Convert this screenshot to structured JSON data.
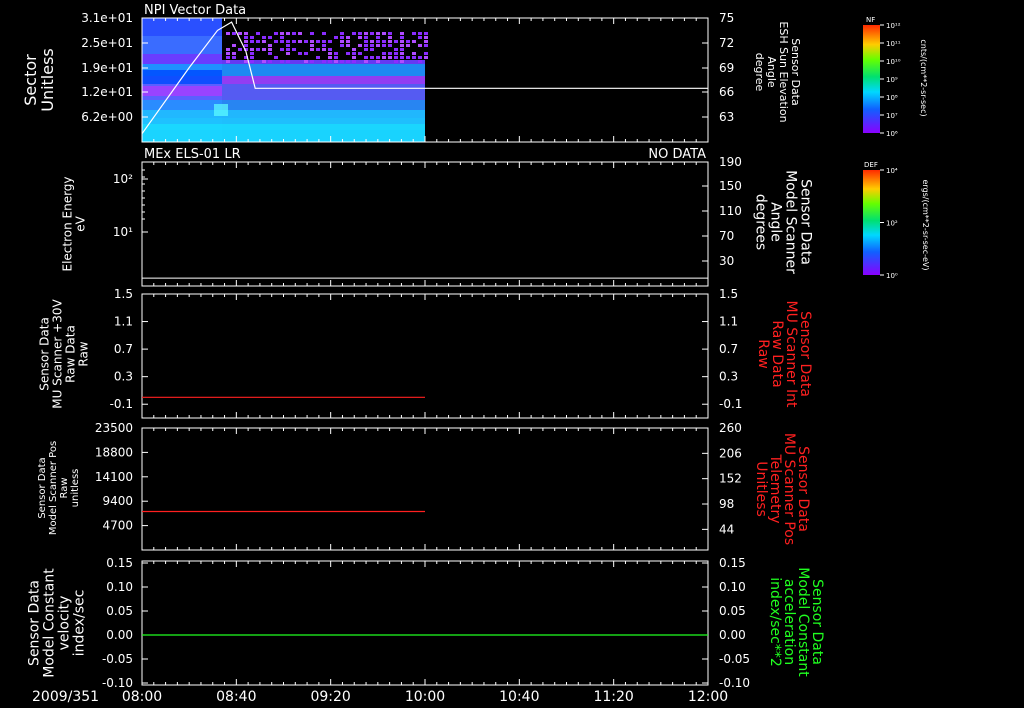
{
  "colors": {
    "background": "#000000",
    "foreground": "#ffffff",
    "right_axis_red": "#ff2020",
    "right_axis_green": "#20ff20",
    "trace_red": "#ff2020",
    "trace_green": "#20ff20",
    "trace_white": "#ffffff"
  },
  "time_axis": {
    "date_label": "2009/351",
    "ticks": [
      "08:00",
      "08:40",
      "09:20",
      "10:00",
      "10:40",
      "11:20",
      "12:00"
    ],
    "data_end": "10:00"
  },
  "chart_data": [
    {
      "type": "heatmap",
      "title": "NPI Vector Data",
      "ylabel": "Sector\nUnitless",
      "y_ticks": [
        "3.1e+01",
        "2.5e+01",
        "1.9e+01",
        "1.2e+01",
        "6.2e+00"
      ],
      "right_axis": {
        "label": "Sensor Data\nESH Sun Elevation\nAngle\ndegree",
        "ticks": [
          "75",
          "72",
          "69",
          "66",
          "63"
        ],
        "ylim": [
          60,
          75
        ],
        "color": "#ffffff"
      },
      "overlay_series": {
        "name": "ESH Sun Elevation Angle",
        "x": [
          "08:00",
          "08:20",
          "08:32",
          "08:38",
          "08:44",
          "08:48",
          "10:00",
          "12:00"
        ],
        "y": [
          61,
          69,
          73.5,
          74.5,
          71,
          66.5,
          66.5,
          66.5
        ],
        "color": "#ffffff"
      },
      "colorbar": {
        "label": "NF",
        "units": "cnts/(cm**2-sr-sec)",
        "ticks": [
          "10¹²",
          "10¹¹",
          "10¹⁰",
          "10⁹",
          "10⁸",
          "10⁷",
          "10⁶"
        ]
      }
    },
    {
      "type": "line",
      "title": "MEx ELS-01 LR",
      "status": "NO DATA",
      "ylabel": "Electron Energy\neV",
      "y_ticks": [
        "10²",
        "10¹"
      ],
      "right_axis": {
        "label": "Sensor Data\nModel Scanner\nAngle\ndegrees",
        "ticks": [
          "190",
          "150",
          "110",
          "70",
          "30"
        ],
        "ylim": [
          0,
          190
        ],
        "color": "#ffffff"
      },
      "series": [
        {
          "name": "Scanner Angle",
          "x": [
            "08:00",
            "12:00"
          ],
          "y": [
            12,
            12
          ],
          "color": "#ffffff"
        }
      ],
      "colorbar": {
        "label": "DEF",
        "units": "ergs/(cm**2-sr-sec-eV)",
        "ticks": [
          "10⁴",
          "10²",
          "10⁰"
        ]
      }
    },
    {
      "type": "line",
      "ylabel": "Sensor Data\nMU Scanner +30V\nRaw Data\nRaw",
      "y_ticks": [
        "1.5",
        "1.1",
        "0.7",
        "0.3",
        "-0.1"
      ],
      "ylim": [
        -0.3,
        1.5
      ],
      "right_axis": {
        "label": "Sensor Data\nMU Scanner Int\nRaw Data\nRaw",
        "ticks": [
          "1.5",
          "1.1",
          "0.7",
          "0.3",
          "-0.1"
        ],
        "color": "#ff2020"
      },
      "series": [
        {
          "name": "MU Scanner Int Raw Data",
          "x": [
            "08:00",
            "10:00"
          ],
          "y": [
            0.0,
            0.0
          ],
          "color": "#ff2020"
        }
      ]
    },
    {
      "type": "line",
      "ylabel": "Sensor Data\nModel Scanner Pos\nRaw\nunitless",
      "y_ticks": [
        "23500",
        "18800",
        "14100",
        "9400",
        "4700"
      ],
      "ylim": [
        0,
        23500
      ],
      "right_axis": {
        "label": "Sensor Data\nMU Scanner Pos\nTelemetry\nUnitless",
        "ticks": [
          "260",
          "206",
          "152",
          "98",
          "44"
        ],
        "ylim": [
          0,
          260
        ],
        "color": "#ff2020"
      },
      "series": [
        {
          "name": "MU Scanner Pos Telemetry",
          "axis": "right",
          "x": [
            "08:00",
            "10:00"
          ],
          "y": [
            82,
            82
          ],
          "color": "#ff2020"
        }
      ]
    },
    {
      "type": "line",
      "ylabel": "Sensor Data\nModel Constant\nvelocity\nindex/sec",
      "y_ticks": [
        "0.15",
        "0.10",
        "0.05",
        "0.00",
        "-0.05",
        "-0.10"
      ],
      "ylim": [
        -0.1,
        0.15
      ],
      "right_axis": {
        "label": "Sensor Data\nModel Constant\nacceleration\nindex/sec**2",
        "ticks": [
          "0.15",
          "0.10",
          "0.05",
          "0.00",
          "-0.05",
          "-0.10"
        ],
        "color": "#20ff20"
      },
      "series": [
        {
          "name": "Model Constant acceleration",
          "axis": "right",
          "x": [
            "08:00",
            "12:00"
          ],
          "y": [
            0.0,
            0.0
          ],
          "color": "#20ff20"
        }
      ]
    }
  ]
}
